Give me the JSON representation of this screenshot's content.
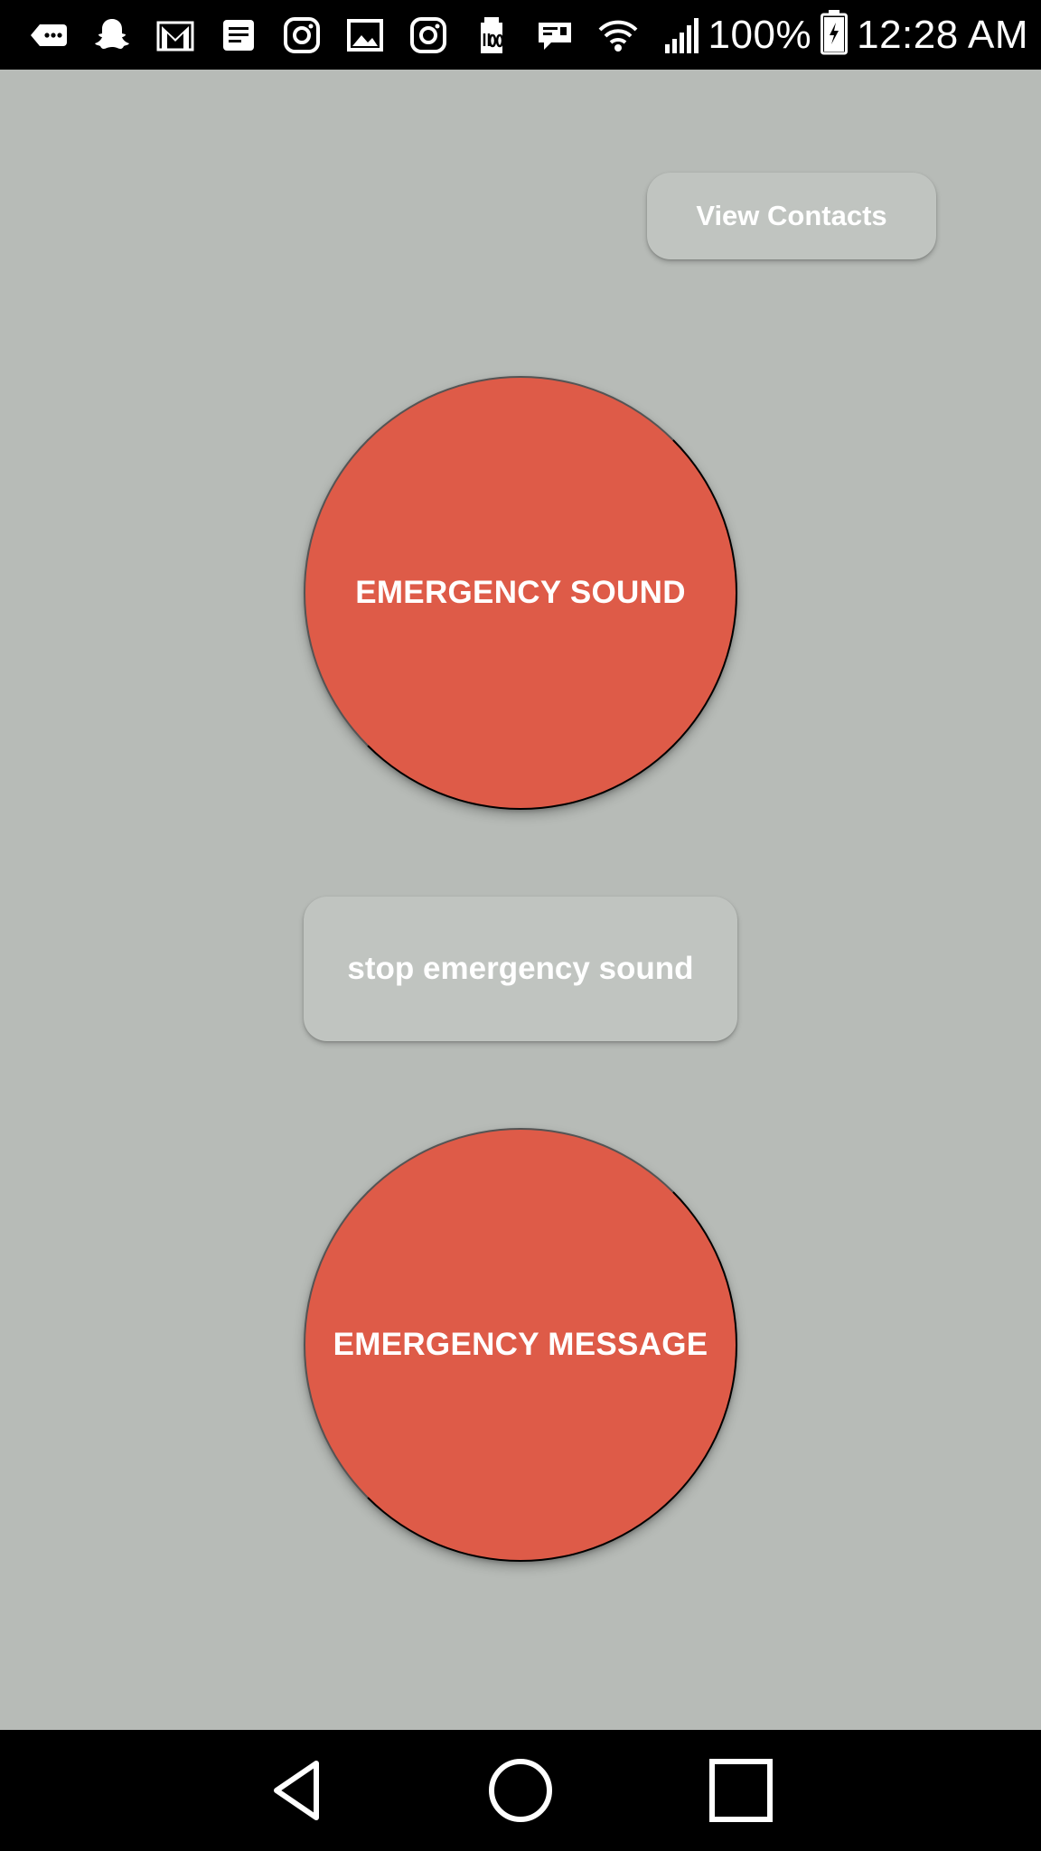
{
  "status_bar": {
    "icons": [
      "message-icon",
      "snapchat-icon",
      "gmail-icon",
      "notes-icon",
      "instagram-icon",
      "gallery-icon",
      "instagram-icon",
      "storage-icon",
      "news-icon",
      "wifi-icon",
      "signal-icon"
    ],
    "battery_percent": "100%",
    "time": "12:28 AM"
  },
  "main": {
    "view_contacts_label": "View Contacts",
    "emergency_sound_label": "EMERGENCY SOUND",
    "stop_sound_label": "stop emergency sound",
    "emergency_message_label": "EMERGENCY MESSAGE"
  },
  "colors": {
    "background": "#b7bbb7",
    "accent": "#de5b48",
    "secondary_button": "#c0c4c0"
  },
  "nav_bar": {
    "buttons": [
      "back-icon",
      "home-icon",
      "recents-icon"
    ]
  }
}
